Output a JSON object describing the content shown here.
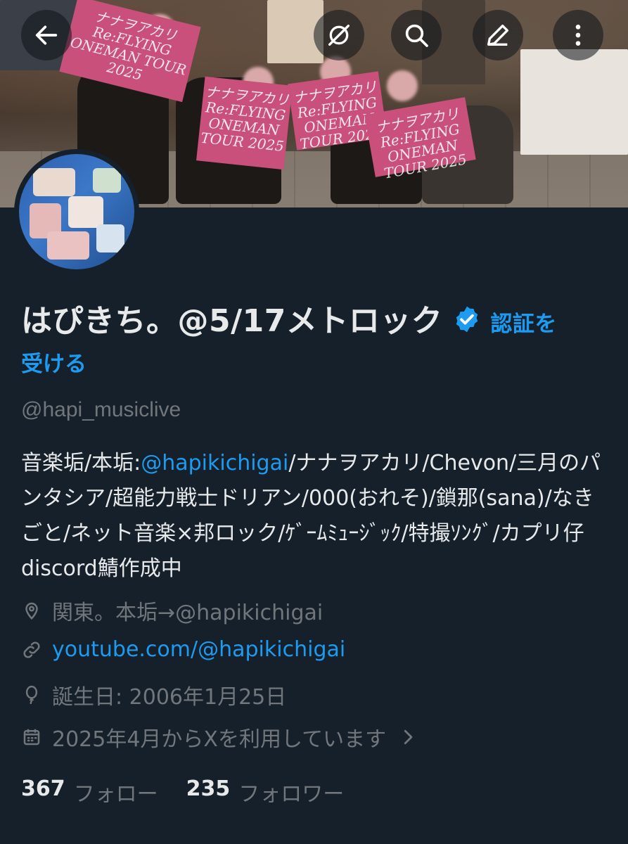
{
  "header": {
    "back_icon": "arrow-left-icon",
    "sync_off_icon": "sync-off-icon",
    "search_icon": "search-icon",
    "edit_icon": "pencil-icon",
    "more_icon": "more-vertical-icon"
  },
  "banner": {
    "towel_text": "ナナヲアカリ Re:FLYING ONEMAN TOUR 2025"
  },
  "profile": {
    "display_name": "はぴきち。@5/17メトロック",
    "verify_line1": "認証を",
    "verify_line2": "受ける",
    "handle": "@hapi_musiclive",
    "bio_parts": {
      "p1": "音楽垢/本垢:",
      "mention": "@hapikichigai",
      "p2": "/ナナヲアカリ/Chevon/三月のパンタシア/超能力戦士ドリアン/000(おれそ)/鎖那(sana)/なきごと/ネット音楽×邦ロック/ｹﾞｰﾑﾐｭｰｼﾞｯｸ/特撮ｿﾝｸﾞ/カプリ仔discord鯖作成中"
    },
    "location": "関東。本垢→@hapikichigai",
    "website": "youtube.com/@hapikichigai",
    "birthday": "誕生日: 2006年1月25日",
    "joined": "2025年4月からXを利用しています",
    "following_count": "367",
    "following_label": "フォロー",
    "followers_count": "235",
    "followers_label": "フォロワー"
  },
  "colors": {
    "background": "#15202b",
    "accent": "#1d9bf0",
    "muted": "#71767b",
    "text": "#e7e9ea"
  }
}
